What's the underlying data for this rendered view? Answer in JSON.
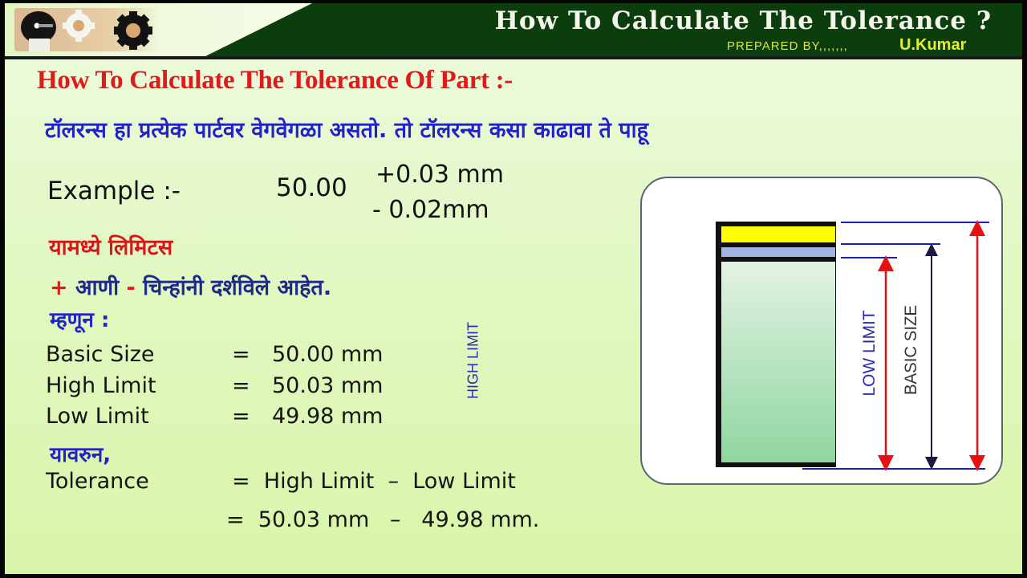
{
  "header": {
    "title": "How To Calculate The Tolerance ?",
    "prepared_by": "PREPARED  BY,,,,,,,",
    "author": "U.Kumar",
    "logo_icon": "gears-logo-icon"
  },
  "heading": "How To Calculate The Tolerance Of Part :-",
  "intro_marathi": "टॉलरन्स हा प्रत्येक पार्टवर वेगवेगळा असतो.   तो टॉलरन्स कसा काढावा ते पाहू",
  "example": {
    "label": "Example :-",
    "basic": "50.00",
    "upper_deviation": "+0.03 mm",
    "lower_deviation": "- 0.02mm"
  },
  "limits_line": "यामध्ये लिमिटस",
  "signs_line": {
    "plus": "+",
    "and": " आणी ",
    "minus": "-",
    "rest": " चिन्हांनी दर्शविले आहेत."
  },
  "therefore": "म्हणून :",
  "values": [
    {
      "label": "Basic Size",
      "eq": "=",
      "value": "50.00 mm"
    },
    {
      "label": "High Limit",
      "eq": "=",
      "value": "50.03 mm"
    },
    {
      "label": "Low Limit",
      "eq": "=",
      "value": "49.98 mm"
    }
  ],
  "hence": "यावरुन,",
  "tolerance": {
    "label": "Tolerance",
    "formula": "=  High Limit  –  Low Limit",
    "substitution": "=  50.03 mm   –   49.98 mm."
  },
  "diagram": {
    "high_limit_label": "HIGH LIMIT",
    "low_limit_label": "LOW LIMIT",
    "basic_size_label": "BASIC SIZE",
    "colors": {
      "high_band": "#ffff00",
      "low_band": "#9fb4e0",
      "body_top": "#e3f3e3",
      "body_bottom": "#8fd6a0",
      "ref_lines": "#1c1cc8",
      "red_arrows": "#e81010",
      "basic_arrow": "#1a1a40"
    }
  },
  "colors": {
    "header_dark": "#0c3d0c",
    "heading_red": "#e01a1a",
    "marathi_blue": "#2222c8",
    "author_yellow": "#e6ee2a"
  }
}
